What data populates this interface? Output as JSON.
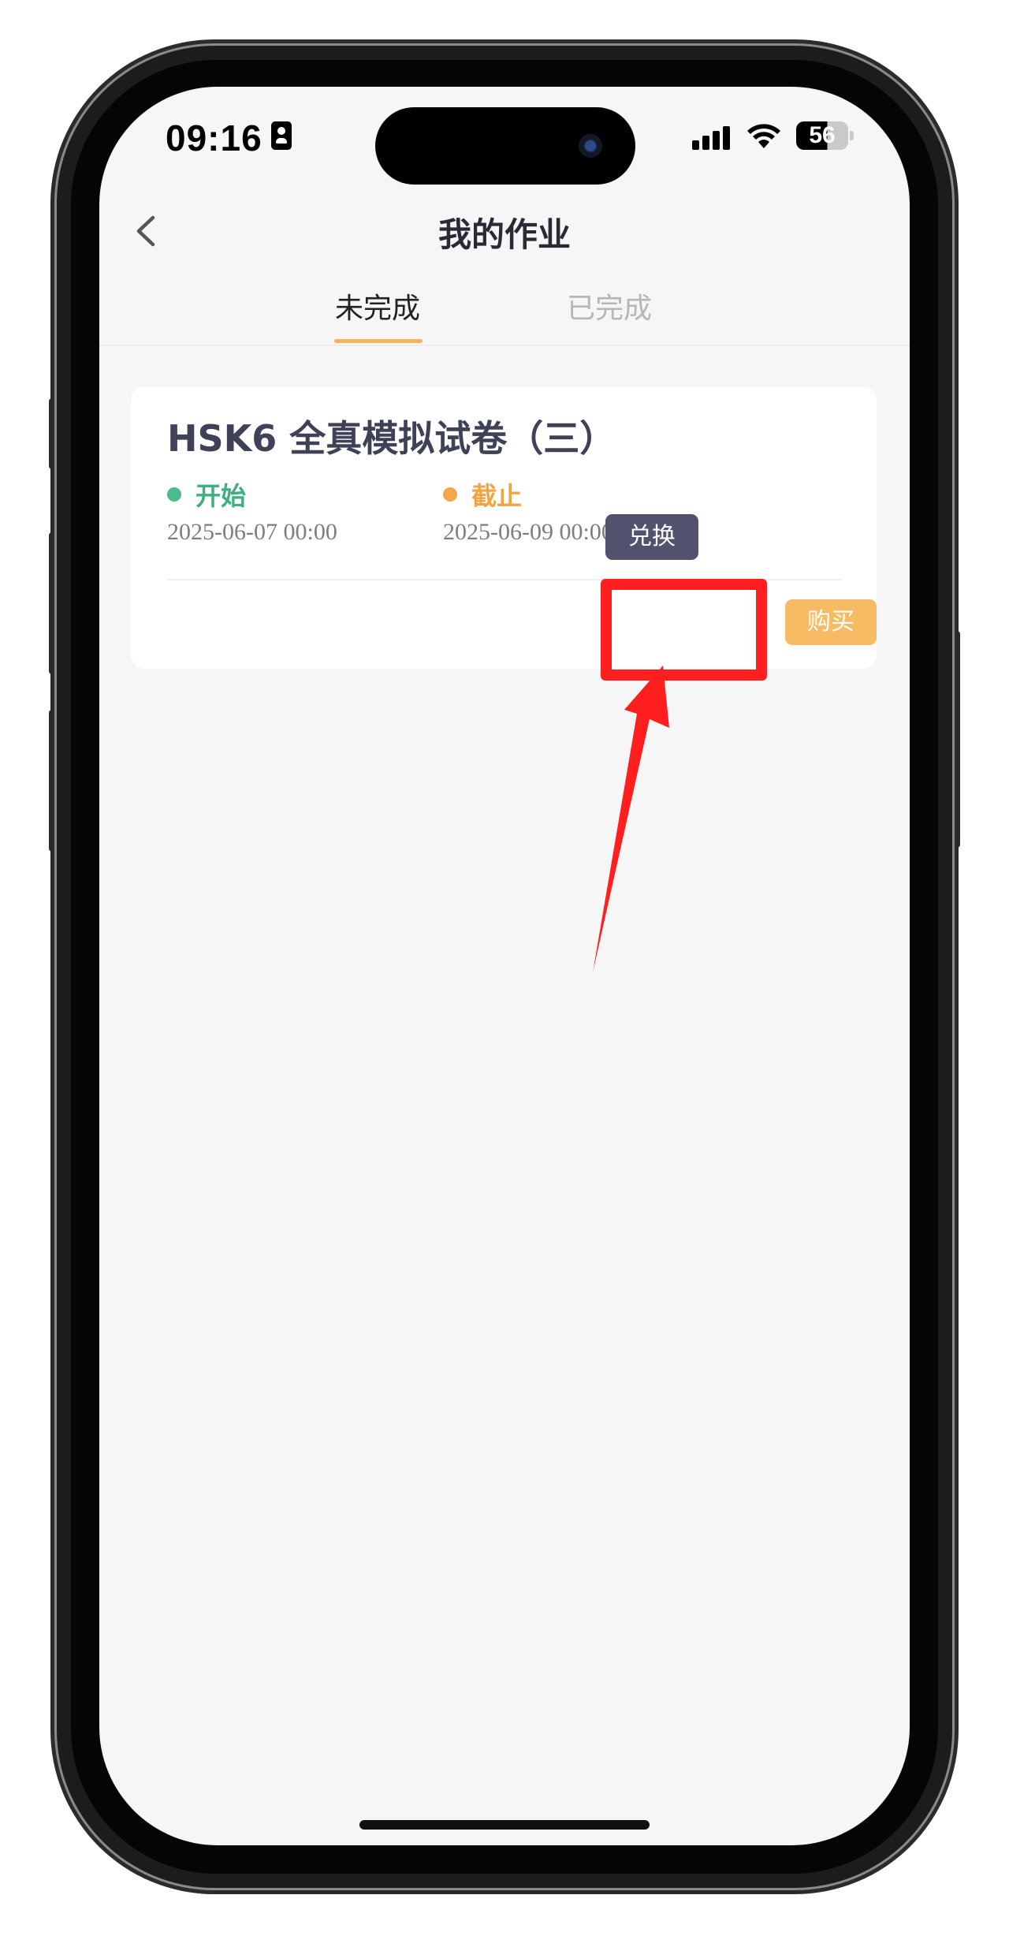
{
  "status_bar": {
    "time": "09:16",
    "battery": "56"
  },
  "nav": {
    "title": "我的作业",
    "back_icon": "chevron-left-icon"
  },
  "tabs": [
    {
      "label": "未完成",
      "active": true
    },
    {
      "label": "已完成",
      "active": false
    }
  ],
  "card": {
    "title": "HSK6 全真模拟试卷（三）",
    "start_label": "开始",
    "start_date": "2025-06-07 00:00",
    "end_label": "截止",
    "end_date": "2025-06-09 00:00",
    "redeem_label": "兑换",
    "buy_label": "购买"
  },
  "colors": {
    "accent": "#f3b45a",
    "redeem": "#51526d",
    "buy": "#f7bb63",
    "start": "#4dbb8b",
    "end": "#f3a74a",
    "annotation": "#ff1f1f"
  }
}
